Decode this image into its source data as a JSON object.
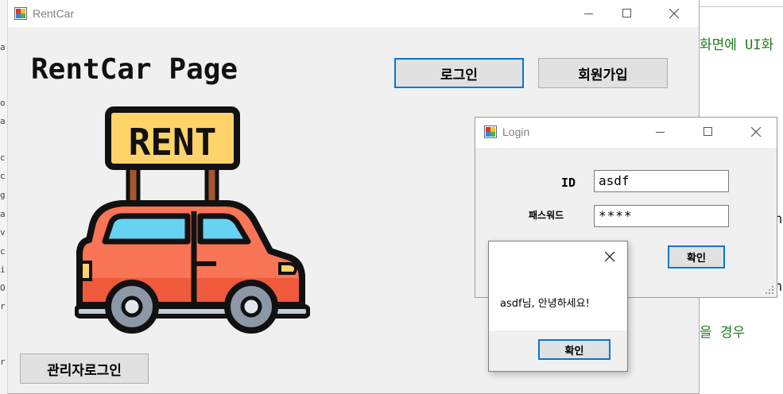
{
  "background_code": {
    "line1": "화면에 UI화",
    "line2": "n",
    "line3": "n",
    "line4": "을 경우",
    "left_gutter": [
      "a",
      "o",
      "a",
      "c",
      "c",
      "g",
      "a",
      "v",
      "c",
      "i",
      "O",
      "r",
      "r"
    ]
  },
  "main_window": {
    "title": "RentCar",
    "brand": "RentCar Page",
    "login_button": "로그인",
    "signup_button": "회원가입",
    "admin_login_button": "관리자로그인",
    "logo_sign_text": "RENT"
  },
  "login_dialog": {
    "title": "Login",
    "id_label": "ID",
    "id_value": "asdf",
    "password_label": "패스워드",
    "password_value": "****",
    "confirm_button": "확인"
  },
  "message_box": {
    "message": "asdf님, 안녕하세요!",
    "ok_button": "확인"
  },
  "colors": {
    "focus_border": "#0078d7",
    "button_face": "#e1e1e1",
    "window_bg": "#f0f0f0",
    "car_body": "#fa7456",
    "car_window": "#68d2f2",
    "sign_board": "#fdd36a",
    "wheel": "#8c98a5"
  }
}
